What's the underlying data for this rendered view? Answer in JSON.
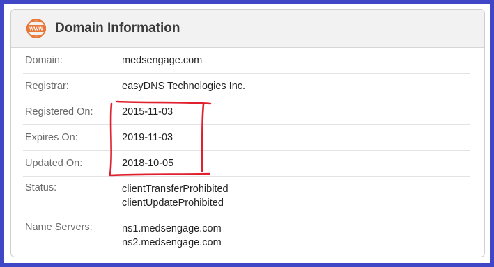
{
  "card": {
    "title": "Domain Information",
    "icon": "www-globe-icon",
    "accent_color": "#e8773a"
  },
  "rows": [
    {
      "label": "Domain:",
      "values": [
        "medsengage.com"
      ]
    },
    {
      "label": "Registrar:",
      "values": [
        "easyDNS Technologies Inc."
      ]
    },
    {
      "label": "Registered On:",
      "values": [
        "2015-11-03"
      ]
    },
    {
      "label": "Expires On:",
      "values": [
        "2019-11-03"
      ]
    },
    {
      "label": "Updated On:",
      "values": [
        "2018-10-05"
      ]
    },
    {
      "label": "Status:",
      "values": [
        "clientTransferProhibited",
        "clientUpdateProhibited"
      ]
    },
    {
      "label": "Name Servers:",
      "values": [
        "ns1.medsengage.com",
        "ns2.medsengage.com"
      ]
    }
  ],
  "annotation": {
    "color": "#e0202e"
  }
}
